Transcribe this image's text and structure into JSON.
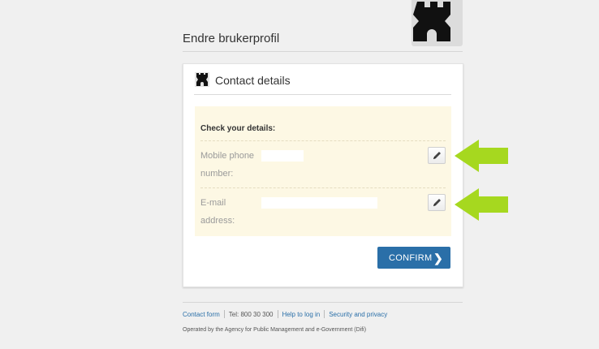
{
  "header": {
    "page_title": "Endre brukerprofil"
  },
  "card": {
    "title": "Contact details",
    "details_heading": "Check your details:",
    "fields": [
      {
        "label": "Mobile phone number:",
        "value": ""
      },
      {
        "label": "E-mail address:",
        "value": ""
      }
    ],
    "confirm_label": "CONFIRM"
  },
  "footer": {
    "links": [
      "Contact form",
      "Help to log in",
      "Security and privacy"
    ],
    "phone": "Tel: 800 30 300",
    "note": "Operated by the Agency for Public Management and e-Government (Difi)"
  },
  "colors": {
    "accent": "#2a6fa8",
    "highlight_bg": "#fdf8e4",
    "arrow": "#a6d81f"
  },
  "icons": {
    "logo": "castle-tower-icon",
    "edit": "pencil-icon",
    "confirm": "chevron-right-icon",
    "annotation": "arrow-left-icon"
  }
}
